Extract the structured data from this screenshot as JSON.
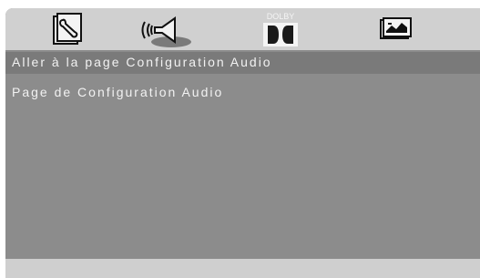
{
  "tabs": [
    {
      "id": "setup",
      "icon": "wrench-icon"
    },
    {
      "id": "audio",
      "icon": "speaker-icon"
    },
    {
      "id": "dolby",
      "icon": "dolby-icon",
      "label": "DOLBY"
    },
    {
      "id": "video",
      "icon": "video-screen-icon"
    }
  ],
  "menu": {
    "selected_label": "Aller à la page Configuration Audio"
  },
  "content": {
    "item_label": "Page de Configuration Audio"
  },
  "colors": {
    "panel": "#8c8c8c",
    "tabbar": "#d0d0d0",
    "highlight": "#7a7a7a",
    "text": "#f2f2f2"
  }
}
